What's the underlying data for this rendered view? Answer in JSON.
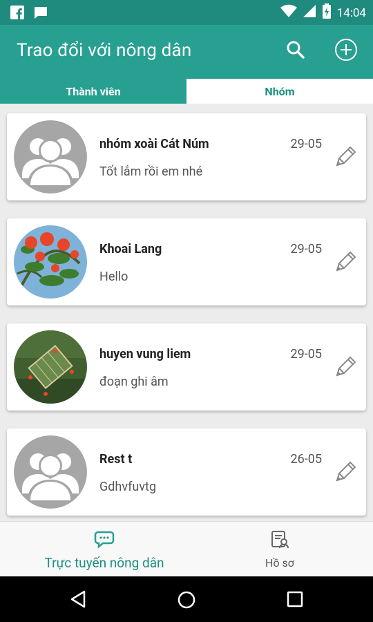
{
  "status_bar": {
    "time": "14:04"
  },
  "app_bar": {
    "title": "Trao đổi với nông dân"
  },
  "tabs": [
    {
      "label": "Thành viên",
      "active": true
    },
    {
      "label": "Nhóm",
      "active": false
    }
  ],
  "conversations": [
    {
      "name": "nhóm xoài Cát Núm",
      "date": "29-05",
      "message": "Tốt lắm rồi em nhé",
      "avatar": "default-group"
    },
    {
      "name": "Khoai Lang",
      "date": "29-05",
      "message": "Hello",
      "avatar": "flower-photo"
    },
    {
      "name": "huyen vung liem",
      "date": "29-05",
      "message": "đoạn ghi âm",
      "avatar": "field-map-photo"
    },
    {
      "name": "Rest t",
      "date": "26-05",
      "message": "Gdhvfuvtg",
      "avatar": "default-group"
    }
  ],
  "bottom_nav": [
    {
      "label": "Trực tuyến nông dân",
      "icon": "chat-icon",
      "active": true
    },
    {
      "label": "Hồ sơ",
      "icon": "profile-doc-icon",
      "active": false
    }
  ],
  "colors": {
    "primary": "#27a091",
    "primary_dark": "#1f8a7e",
    "accent_text": "#1b8f83"
  }
}
